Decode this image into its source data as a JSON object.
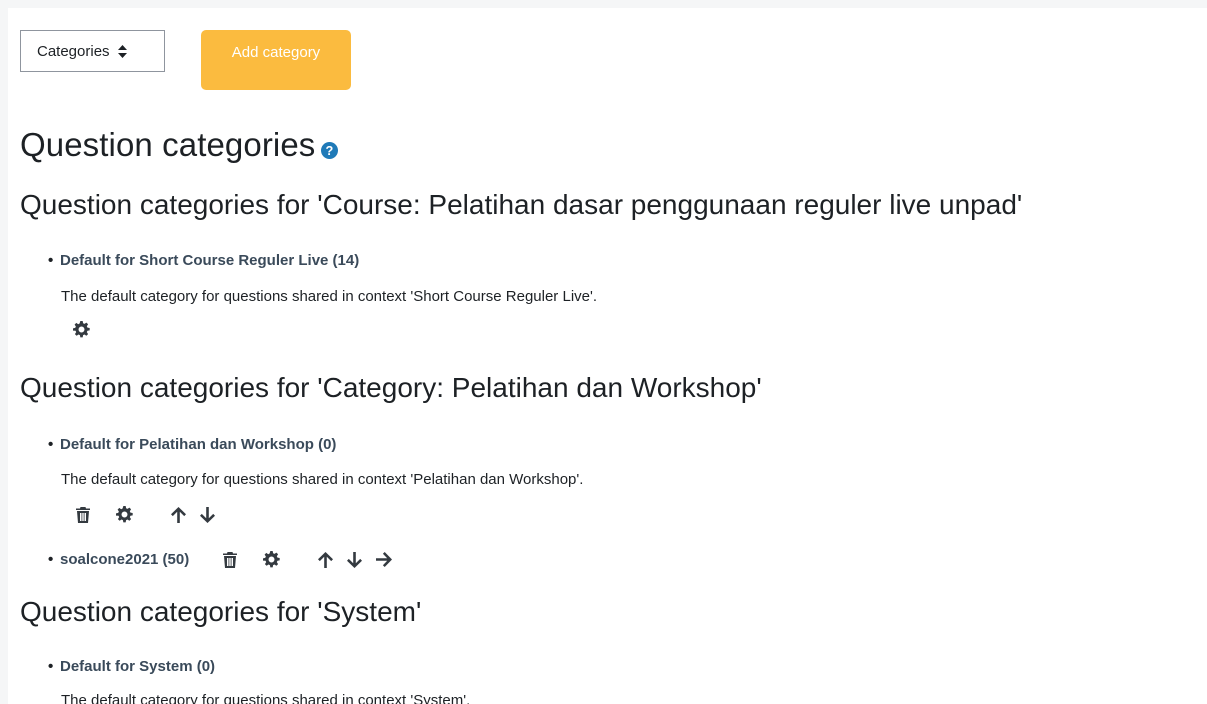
{
  "toolbar": {
    "select_value": "Categories",
    "add_category_label": "Add category"
  },
  "page_title": "Question categories",
  "sections": [
    {
      "heading": "Question categories for 'Course: Pelatihan dasar penggunaan reguler live unpad'",
      "items": [
        {
          "label": "Default for Short Course Reguler Live (14)",
          "description": "The default category for questions shared in context 'Short Course Reguler Live'.",
          "actions": [
            "gear-icon"
          ]
        }
      ]
    },
    {
      "heading": "Question categories for 'Category: Pelatihan dan Workshop'",
      "items": [
        {
          "label": "Default for Pelatihan dan Workshop (0)",
          "description": "The default category for questions shared in context 'Pelatihan dan Workshop'.",
          "actions": [
            "trash-icon",
            "gear-icon",
            "arrow-up-icon",
            "arrow-down-icon"
          ]
        },
        {
          "label": "soalcone2021 (50)",
          "description": "",
          "actions": [
            "trash-icon",
            "gear-icon",
            "arrow-up-icon",
            "arrow-down-icon",
            "arrow-right-icon"
          ]
        }
      ]
    },
    {
      "heading": "Question categories for 'System'",
      "items": [
        {
          "label": "Default for System (0)",
          "description": "The default category for questions shared in context 'System'.",
          "actions": []
        }
      ]
    }
  ],
  "colors": {
    "accent": "#fbbb3f",
    "link": "#3a4a5a",
    "help_icon": "#1f7ab8",
    "icon": "#343a40"
  }
}
